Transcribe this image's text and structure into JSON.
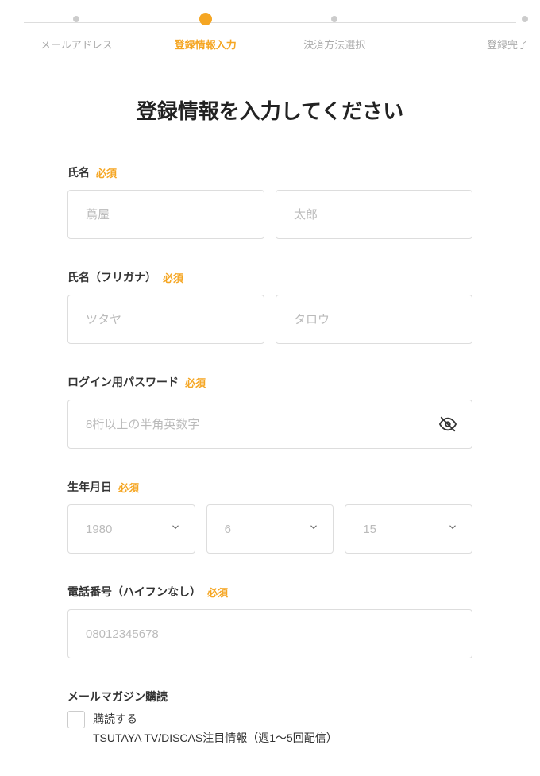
{
  "stepper": {
    "steps": [
      {
        "label": "メールアドレス",
        "active": false
      },
      {
        "label": "登録情報入力",
        "active": true
      },
      {
        "label": "決済方法選択",
        "active": false
      },
      {
        "label": "登録完了",
        "active": false
      }
    ]
  },
  "page_title": "登録情報を入力してください",
  "required_label": "必須",
  "fields": {
    "name": {
      "label": "氏名",
      "last_placeholder": "蔦屋",
      "first_placeholder": "太郎"
    },
    "name_kana": {
      "label": "氏名（フリガナ）",
      "last_placeholder": "ツタヤ",
      "first_placeholder": "タロウ"
    },
    "password": {
      "label": "ログイン用パスワード",
      "placeholder": "8桁以上の半角英数字"
    },
    "birthdate": {
      "label": "生年月日",
      "year": "1980",
      "month": "6",
      "day": "15"
    },
    "phone": {
      "label": "電話番号（ハイフンなし）",
      "placeholder": "08012345678"
    },
    "newsletter": {
      "label": "メールマガジン購読",
      "checkbox_label": "購読する",
      "sublabel": "TSUTAYA TV/DISCAS注目情報（週1～5回配信）"
    }
  }
}
